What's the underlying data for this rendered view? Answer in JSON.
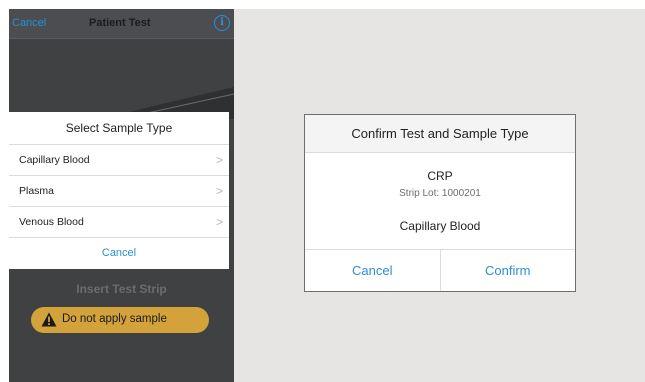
{
  "phone": {
    "nav": {
      "cancel_label": "Cancel",
      "title": "Patient Test",
      "info_icon": "info-icon"
    },
    "sheet": {
      "title": "Select Sample Type",
      "options": [
        {
          "label": "Capillary Blood"
        },
        {
          "label": "Plasma"
        },
        {
          "label": "Venous Blood"
        }
      ],
      "cancel_label": "Cancel"
    },
    "status_text": "Insert Test Strip",
    "warning": {
      "icon": "warning-icon",
      "text": "Do not apply sample"
    }
  },
  "dialog": {
    "title": "Confirm Test and Sample Type",
    "test_name": "CRP",
    "strip_lot": "Strip Lot: 1000201",
    "sample_type": "Capillary Blood",
    "cancel_label": "Cancel",
    "confirm_label": "Confirm"
  },
  "colors": {
    "accent": "#2a8fd8",
    "warning": "#d4a23a",
    "phone_background": "#3f4143",
    "tablet_background": "#e6e5e3"
  }
}
